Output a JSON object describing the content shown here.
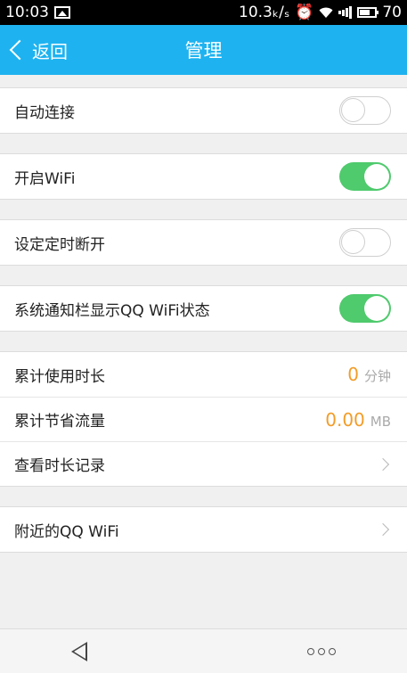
{
  "status_bar": {
    "time": "10:03",
    "speed": "10.3ₖ/ₛ",
    "battery": "70"
  },
  "nav": {
    "back_label": "返回",
    "title": "管理"
  },
  "settings": {
    "auto_connect": {
      "label": "自动连接",
      "enabled": false
    },
    "open_wifi": {
      "label": "开启WiFi",
      "enabled": true
    },
    "timed_disconnect": {
      "label": "设定定时断开",
      "enabled": false
    },
    "notify_status": {
      "label": "系统通知栏显示QQ WiFi状态",
      "enabled": true
    }
  },
  "stats": {
    "usage_time": {
      "label": "累计使用时长",
      "value": "0",
      "unit": "分钟"
    },
    "data_saved": {
      "label": "累计节省流量",
      "value": "0.00",
      "unit": "MB"
    },
    "history": {
      "label": "查看时长记录"
    }
  },
  "nearby": {
    "label": "附近的QQ WiFi"
  },
  "colors": {
    "accent": "#1eb3f0",
    "toggle_on": "#4fca6d",
    "value": "#f29d2a"
  },
  "icons": [
    "image-icon",
    "alarm-icon",
    "wifi-icon",
    "signal-icon",
    "battery-icon",
    "back-chevron-icon",
    "chevron-right-icon",
    "back-triangle-icon",
    "more-dots-icon"
  ]
}
